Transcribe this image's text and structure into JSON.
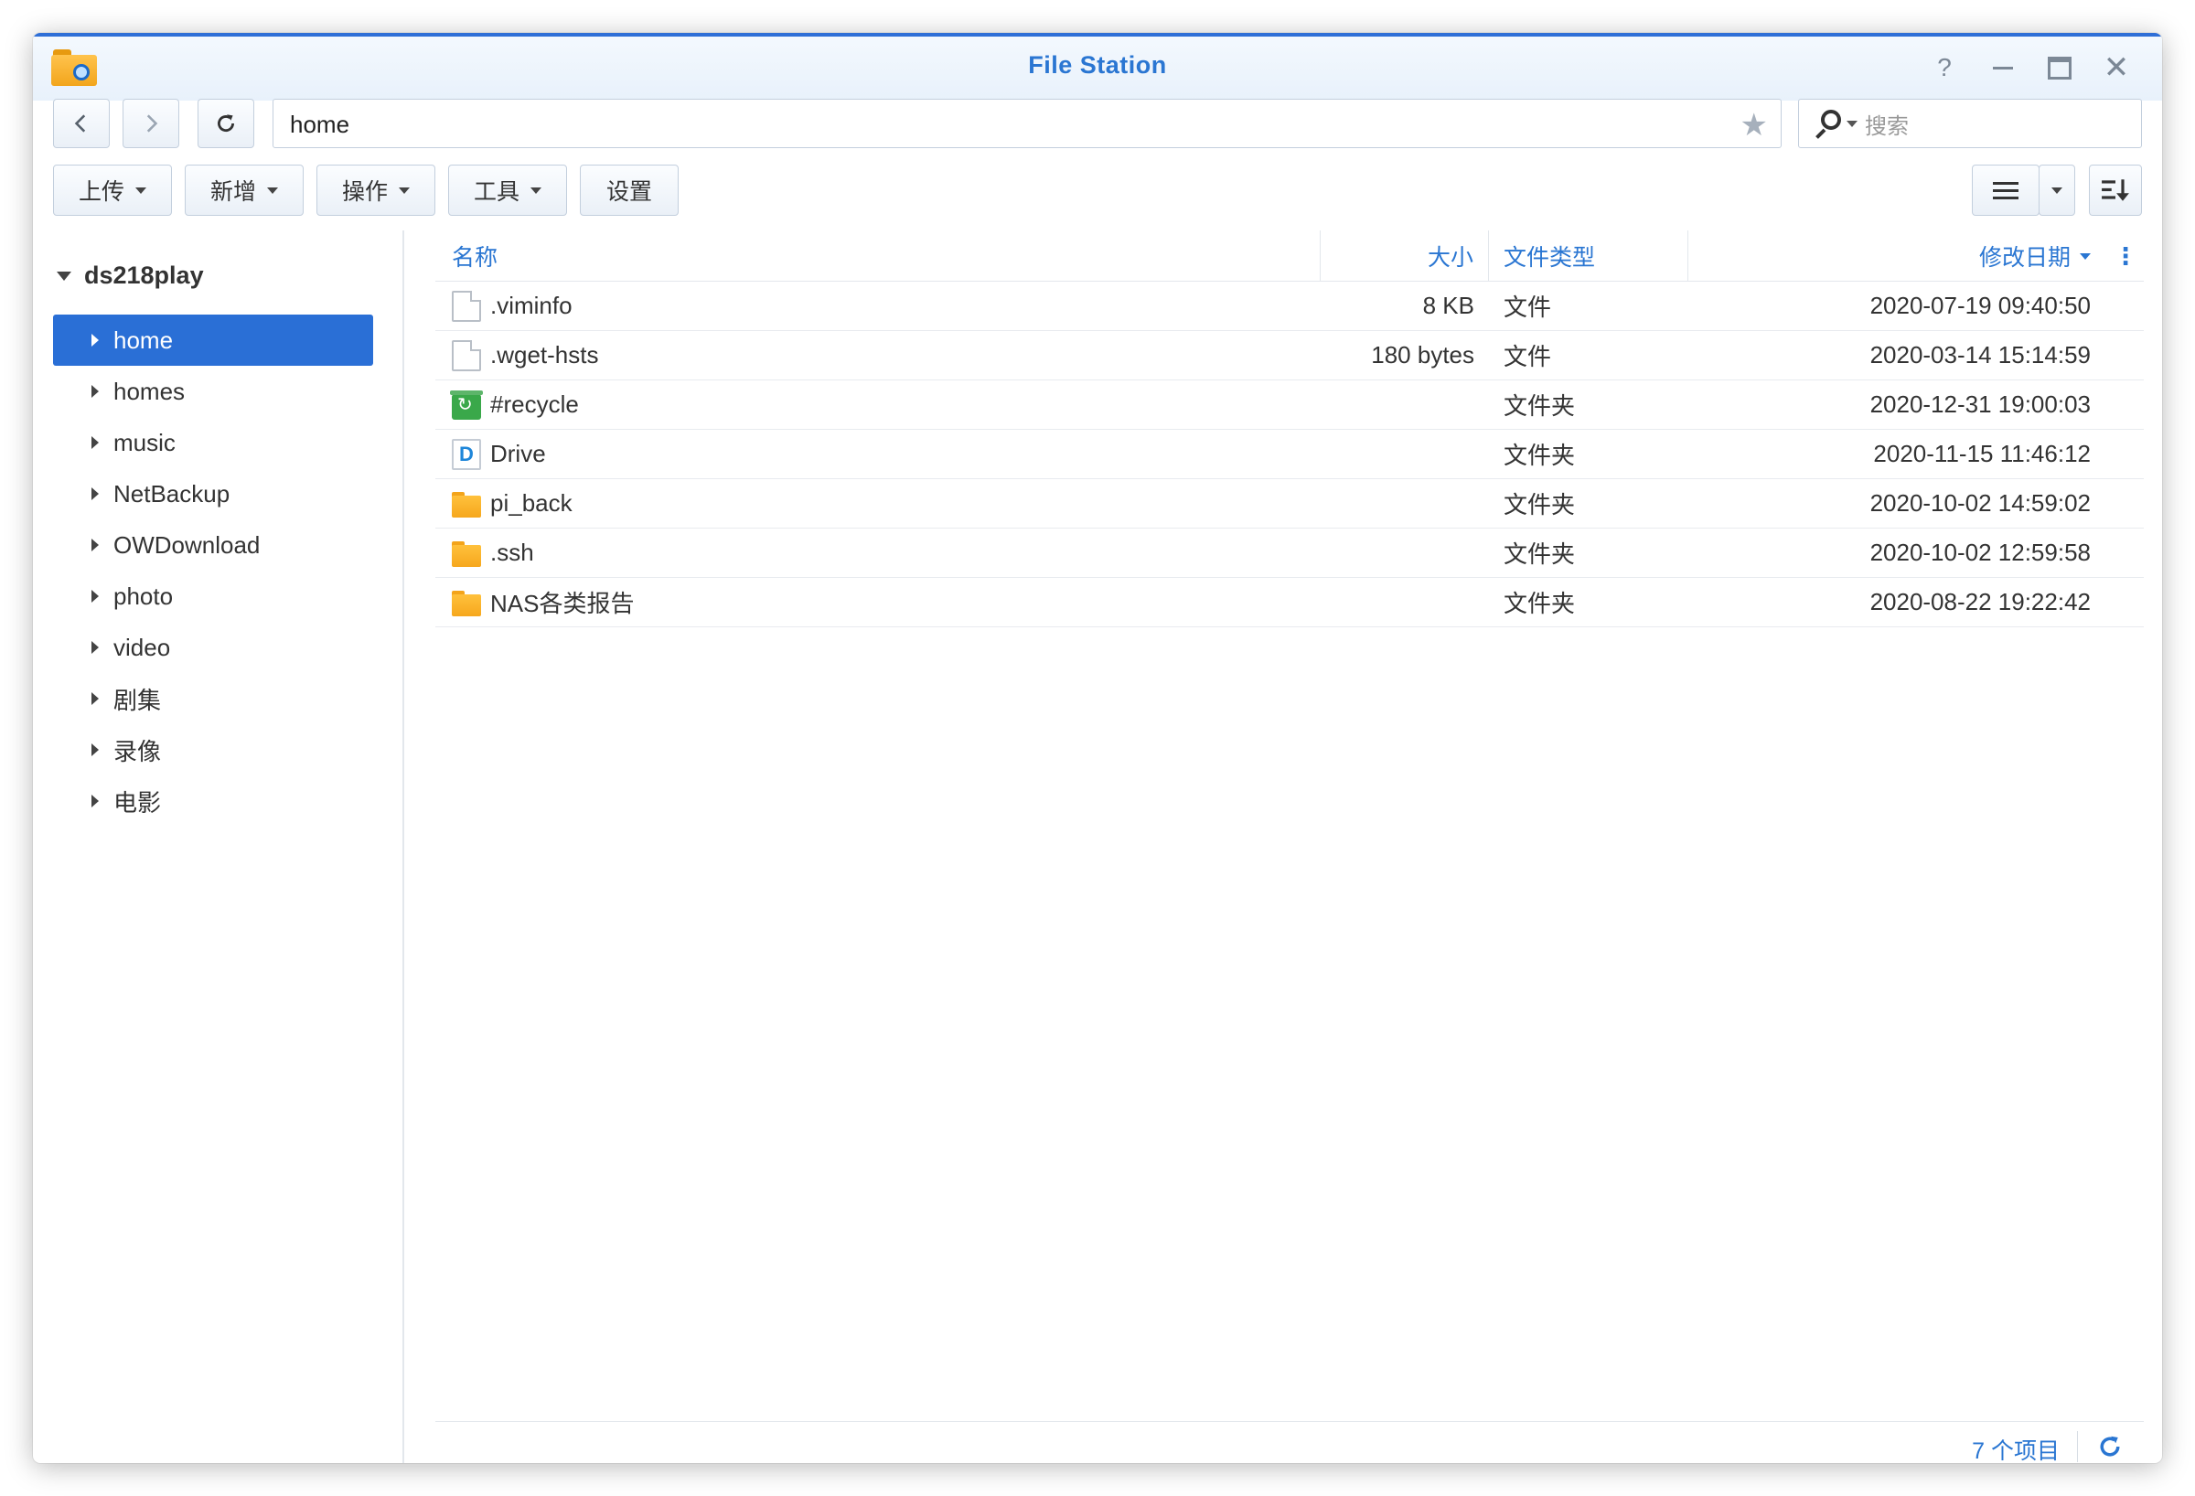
{
  "window": {
    "title": "File Station"
  },
  "nav": {
    "path": "home",
    "search_placeholder": "搜索"
  },
  "toolbar": {
    "upload": "上传",
    "new": "新增",
    "action": "操作",
    "tools": "工具",
    "settings": "设置"
  },
  "sidebar": {
    "root": "ds218play",
    "items": [
      {
        "label": "home",
        "selected": true
      },
      {
        "label": "homes"
      },
      {
        "label": "music"
      },
      {
        "label": "NetBackup"
      },
      {
        "label": "OWDownload"
      },
      {
        "label": "photo"
      },
      {
        "label": "video"
      },
      {
        "label": "剧集"
      },
      {
        "label": "录像"
      },
      {
        "label": "电影"
      }
    ]
  },
  "table": {
    "columns": {
      "name": "名称",
      "size": "大小",
      "type": "文件类型",
      "modified": "修改日期"
    },
    "rows": [
      {
        "name": ".viminfo",
        "size": "8 KB",
        "type": "文件",
        "modified": "2020-07-19 09:40:50",
        "icon": "file-icon"
      },
      {
        "name": ".wget-hsts",
        "size": "180 bytes",
        "type": "文件",
        "modified": "2020-03-14 15:14:59",
        "icon": "file-icon"
      },
      {
        "name": "#recycle",
        "size": "",
        "type": "文件夹",
        "modified": "2020-12-31 19:00:03",
        "icon": "recycle-bin-icon"
      },
      {
        "name": "Drive",
        "size": "",
        "type": "文件夹",
        "modified": "2020-11-15 11:46:12",
        "icon": "drive-folder-icon"
      },
      {
        "name": "pi_back",
        "size": "",
        "type": "文件夹",
        "modified": "2020-10-02 14:59:02",
        "icon": "folder-icon"
      },
      {
        "name": ".ssh",
        "size": "",
        "type": "文件夹",
        "modified": "2020-10-02 12:59:58",
        "icon": "folder-icon"
      },
      {
        "name": "NAS各类报告",
        "size": "",
        "type": "文件夹",
        "modified": "2020-08-22 19:22:42",
        "icon": "folder-icon"
      }
    ]
  },
  "status": {
    "item_count": "7 个项目"
  },
  "colors": {
    "accent": "#2a76d2",
    "selected": "#2a6fd6",
    "folder": "#f6a71d"
  }
}
